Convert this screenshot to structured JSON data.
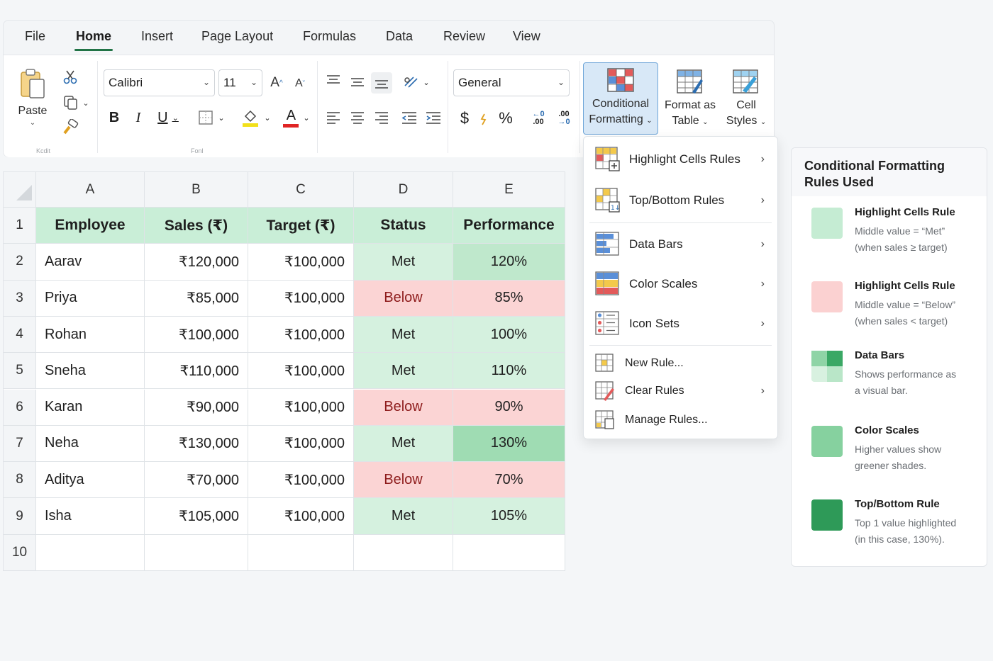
{
  "tabs": [
    "File",
    "Home",
    "Insert",
    "Page Layout",
    "Formulas",
    "Data",
    "Review",
    "View"
  ],
  "active_tab": "Home",
  "ribbon": {
    "paste_label": "Paste",
    "font_name": "Calibri",
    "font_size": "11",
    "number_format": "General",
    "clipboard_caption": "Kcdit",
    "font_caption": "Fonl",
    "conditional_formatting": [
      "Conditional",
      "Formatting"
    ],
    "format_as_table": [
      "Format as",
      "Table"
    ],
    "cell_styles": [
      "Cell",
      "Styles"
    ],
    "glyphs": {
      "bold": "B",
      "italic": "I",
      "underline": "U",
      "font_color": "A",
      "grow": "A",
      "shrink": "A",
      "currency": "$",
      "percent": "%",
      "inc_decimal": ".00",
      "dec_decimal": ".00"
    }
  },
  "sheet": {
    "columns": [
      "A",
      "B",
      "C",
      "D",
      "E"
    ],
    "row_numbers": [
      "1",
      "2",
      "3",
      "4",
      "5",
      "6",
      "7",
      "8",
      "9",
      "10"
    ],
    "headers": [
      "Employee",
      "Sales (₹)",
      "Target (₹)",
      "Status",
      "Performance"
    ],
    "rows": [
      [
        "Aarav",
        "₹120,000",
        "₹100,000",
        "Met",
        "120%"
      ],
      [
        "Priya",
        "₹85,000",
        "₹100,000",
        "Below",
        "85%"
      ],
      [
        "Rohan",
        "₹100,000",
        "₹100,000",
        "Met",
        "100%"
      ],
      [
        "Sneha",
        "₹110,000",
        "₹100,000",
        "Met",
        "110%"
      ],
      [
        "Karan",
        "₹90,000",
        "₹100,000",
        "Below",
        "90%"
      ],
      [
        "Neha",
        "₹130,000",
        "₹100,000",
        "Met",
        "130%"
      ],
      [
        "Aditya",
        "₹70,000",
        "₹100,000",
        "Below",
        "70%"
      ],
      [
        "Isha",
        "₹105,000",
        "₹100,000",
        "Met",
        "105%"
      ]
    ]
  },
  "menu": {
    "items": [
      {
        "label": "Highlight Cells Rules",
        "arrow": "›"
      },
      {
        "label": "Top/Bottom Rules",
        "arrow": "›"
      },
      {
        "label": "Data Bars",
        "arrow": "›"
      },
      {
        "label": "Color Scales",
        "arrow": "›"
      },
      {
        "label": "Icon Sets",
        "arrow": "›"
      },
      {
        "label": "New Rule...",
        "arrow": ""
      },
      {
        "label": "Clear Rules",
        "arrow": "›"
      },
      {
        "label": "Manage Rules...",
        "arrow": ""
      }
    ]
  },
  "panel": {
    "title": "Conditional Formatting Rules Used",
    "rules": [
      {
        "title": "Highlight Cells Rule",
        "lines": [
          "Middle value = “Met”",
          "(when sales ≥ target)"
        ],
        "color": "#c5ecd3"
      },
      {
        "title": "Highlight Cells Rule",
        "lines": [
          "Middle value = “Below”",
          "(when sales < target)"
        ],
        "color": "#fbd1d1"
      },
      {
        "title": "Data Bars",
        "lines": [
          "Shows performance as",
          "a visual bar."
        ],
        "color": "#7fcf98"
      },
      {
        "title": "Color Scales",
        "lines": [
          "Higher values show",
          "greener shades."
        ],
        "color": "#86d19f"
      },
      {
        "title": "Top/Bottom Rule",
        "lines": [
          "Top 1 value highlighted",
          "(in this case, 130%)."
        ],
        "color": "#2e9a58"
      }
    ]
  },
  "colors": {
    "accent": "#217346",
    "met_fill": "#d5f1df",
    "below_fill": "#fbd4d4",
    "header_fill": "#c9eed7",
    "selected_button": "#d8e8f7"
  }
}
